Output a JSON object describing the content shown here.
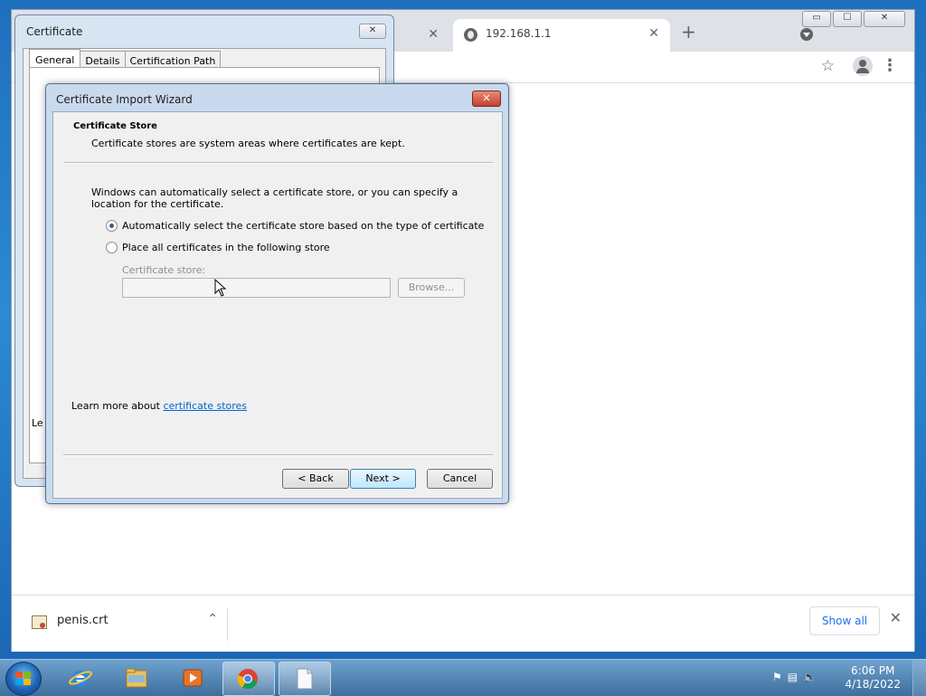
{
  "browser": {
    "tabs": [
      {
        "title": "",
        "close": "✕"
      },
      {
        "title": "192.168.1.1",
        "close": "✕",
        "icon": "globe-icon"
      }
    ],
    "new_tab": "+",
    "window_controls": {
      "minimize": "▭",
      "maximize": "☐",
      "close": "✕"
    }
  },
  "download_bar": {
    "file_name": "penis.crt",
    "show_all": "Show all",
    "close": "✕",
    "chevron": "^"
  },
  "certificate_dialog": {
    "title": "Certificate",
    "close": "✕",
    "tabs": [
      "General",
      "Details",
      "Certification Path"
    ],
    "partial_text": "Le"
  },
  "wizard": {
    "title": "Certificate Import Wizard",
    "close": "✕",
    "section_title": "Certificate Store",
    "section_desc": "Certificate stores are system areas where certificates are kept.",
    "intro": "Windows can automatically select a certificate store, or you can specify a location for the certificate.",
    "options": [
      {
        "label": "Automatically select the certificate store based on the type of certificate",
        "checked": true
      },
      {
        "label": "Place all certificates in the following store",
        "checked": false
      }
    ],
    "store_label": "Certificate store:",
    "store_value": "",
    "browse": "Browse...",
    "learn_prefix": "Learn more about ",
    "learn_link": "certificate stores",
    "buttons": {
      "back": "< Back",
      "next": "Next >",
      "cancel": "Cancel"
    }
  },
  "taskbar": {
    "items": [
      "internet-explorer",
      "windows-explorer",
      "media-player",
      "chrome",
      "blank-document"
    ],
    "time": "6:06 PM",
    "date": "4/18/2022"
  }
}
